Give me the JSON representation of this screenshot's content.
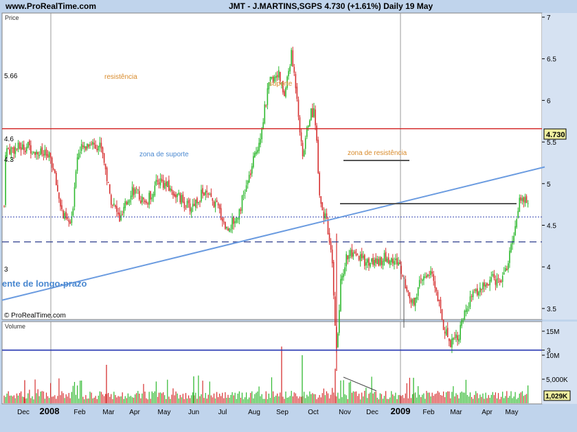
{
  "header": {
    "site": "www.ProRealTime.com",
    "title": "JMT - J.MARTINS,SGPS    4.730 (+1.61%)    Daily  19 May"
  },
  "price_panel": {
    "label": "Price",
    "watermark": "© ProRealTime.com",
    "last_price": "4.730",
    "annotations": {
      "resistencia": "resistência",
      "suporte": "suporte",
      "zona_suporte": "zona de suporte",
      "zona_resistencia": "zona de resistência",
      "longo_prazo": "ente de longo-prazo",
      "level_566": "5.66",
      "level_46": "4.6",
      "level_43": "4.3",
      "level_3": "3"
    }
  },
  "volume_panel": {
    "label": "Volume",
    "last_volume": "1,029K"
  },
  "colors": {
    "up": "#2eb82e",
    "down": "#d63030",
    "resistance_line": "#d22020",
    "trend_line": "#6a9be0",
    "support_line": "#2d3db4",
    "dashed": "#2a3a8c",
    "dotted": "#3a4ab4",
    "annotation_orange": "#d88a2a",
    "annotation_blue": "#4a88d0"
  },
  "chart_data": {
    "type": "candlestick",
    "series": [
      {
        "name": "Price",
        "ylim": [
          2.6,
          7.1
        ],
        "yticks": [
          "7",
          "6.5",
          "6",
          "5.5",
          "5",
          "4.5",
          "4",
          "3.5",
          "3"
        ]
      },
      {
        "name": "Volume",
        "ylim": [
          0,
          16000000
        ],
        "yticks": [
          "15M",
          "10M",
          "5,000K"
        ]
      }
    ],
    "x_labels": [
      "Dec",
      "2008",
      "Feb",
      "Mar",
      "Apr",
      "May",
      "Jun",
      "Jul",
      "Aug",
      "Sep",
      "Oct",
      "Nov",
      "Dec",
      "2009",
      "Feb",
      "Mar",
      "Apr",
      "May"
    ],
    "x_bold": [
      "2008",
      "2009"
    ],
    "horizontal_levels": {
      "resistencia": 5.66,
      "dotted": 4.6,
      "dashed": 4.3,
      "long_term_support": 3.0
    },
    "trendline": {
      "from": [
        0,
        3.6
      ],
      "to": [
        1,
        5.2
      ]
    },
    "approx_path": [
      {
        "x": "Dec",
        "close": 5.4
      },
      {
        "x": "2008",
        "close": 5.3
      },
      {
        "x": "Feb",
        "close": 4.5
      },
      {
        "x": "Feb",
        "close": 5.5
      },
      {
        "x": "Mar",
        "close": 4.8
      },
      {
        "x": "Apr",
        "close": 4.7
      },
      {
        "x": "May",
        "close": 5.1
      },
      {
        "x": "Jun",
        "close": 4.7
      },
      {
        "x": "Jul",
        "close": 4.4
      },
      {
        "x": "Aug",
        "close": 5.5
      },
      {
        "x": "Sep",
        "close": 6.6
      },
      {
        "x": "Oct",
        "close": 5.2
      },
      {
        "x": "Oct",
        "close": 4.4
      },
      {
        "x": "Nov",
        "close": 2.8
      },
      {
        "x": "Nov",
        "close": 4.1
      },
      {
        "x": "Dec",
        "close": 3.8
      },
      {
        "x": "2009",
        "close": 3.6
      },
      {
        "x": "Feb",
        "close": 3.8
      },
      {
        "x": "Mar",
        "close": 3.0
      },
      {
        "x": "Apr",
        "close": 3.7
      },
      {
        "x": "May",
        "close": 4.73
      }
    ]
  }
}
